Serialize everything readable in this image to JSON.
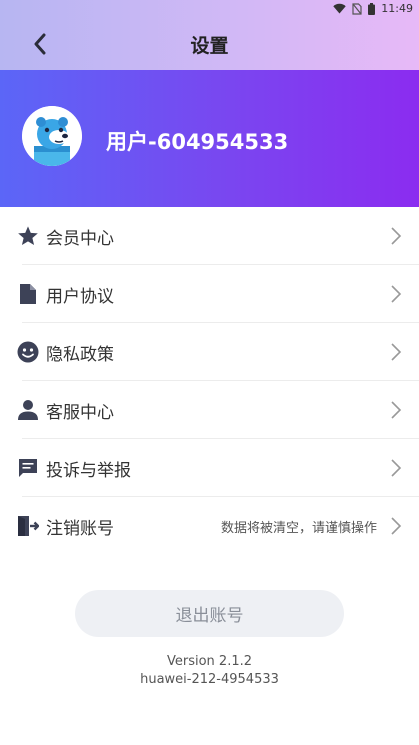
{
  "status_bar": {
    "time": "11:49"
  },
  "header": {
    "title": "设置"
  },
  "profile": {
    "username": "用户-604954533"
  },
  "menu": [
    {
      "label": "会员中心",
      "icon": "star-icon",
      "hint": ""
    },
    {
      "label": "用户协议",
      "icon": "document-icon",
      "hint": ""
    },
    {
      "label": "隐私政策",
      "icon": "smiley-icon",
      "hint": ""
    },
    {
      "label": "客服中心",
      "icon": "person-icon",
      "hint": ""
    },
    {
      "label": "投诉与举报",
      "icon": "message-icon",
      "hint": ""
    },
    {
      "label": "注销账号",
      "icon": "exit-door-icon",
      "hint": "数据将被清空，请谨慎操作"
    }
  ],
  "logout": {
    "label": "退出账号"
  },
  "footer": {
    "version": "Version 2.1.2",
    "build": "huawei-212-4954533"
  },
  "colors": {
    "header_gradient": [
      "#b7b6f2",
      "#e7b9f7"
    ],
    "profile_gradient": [
      "#5b66f7",
      "#8b2cf0"
    ],
    "icon": "#3d4257"
  }
}
